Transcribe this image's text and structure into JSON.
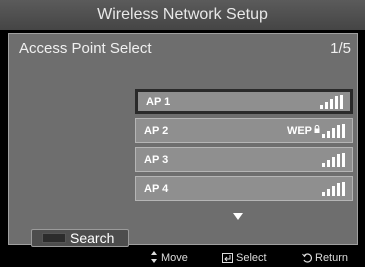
{
  "title": "Wireless Network Setup",
  "subheader": {
    "label": "Access Point Select",
    "page": "1/5"
  },
  "ap_list": [
    {
      "name": "AP 1",
      "security": "",
      "selected": true
    },
    {
      "name": "AP 2",
      "security": "WEP",
      "selected": false
    },
    {
      "name": "AP 3",
      "security": "",
      "selected": false
    },
    {
      "name": "AP 4",
      "security": "",
      "selected": false
    }
  ],
  "search_button": {
    "label": "Search"
  },
  "footer": {
    "move": "Move",
    "select": "Select",
    "return": "Return"
  },
  "icons": {
    "more": "down-arrow-icon",
    "signal": "signal-strength-icon",
    "lock": "lock-icon",
    "move": "move-icon",
    "select": "enter-icon",
    "return": "return-icon"
  }
}
